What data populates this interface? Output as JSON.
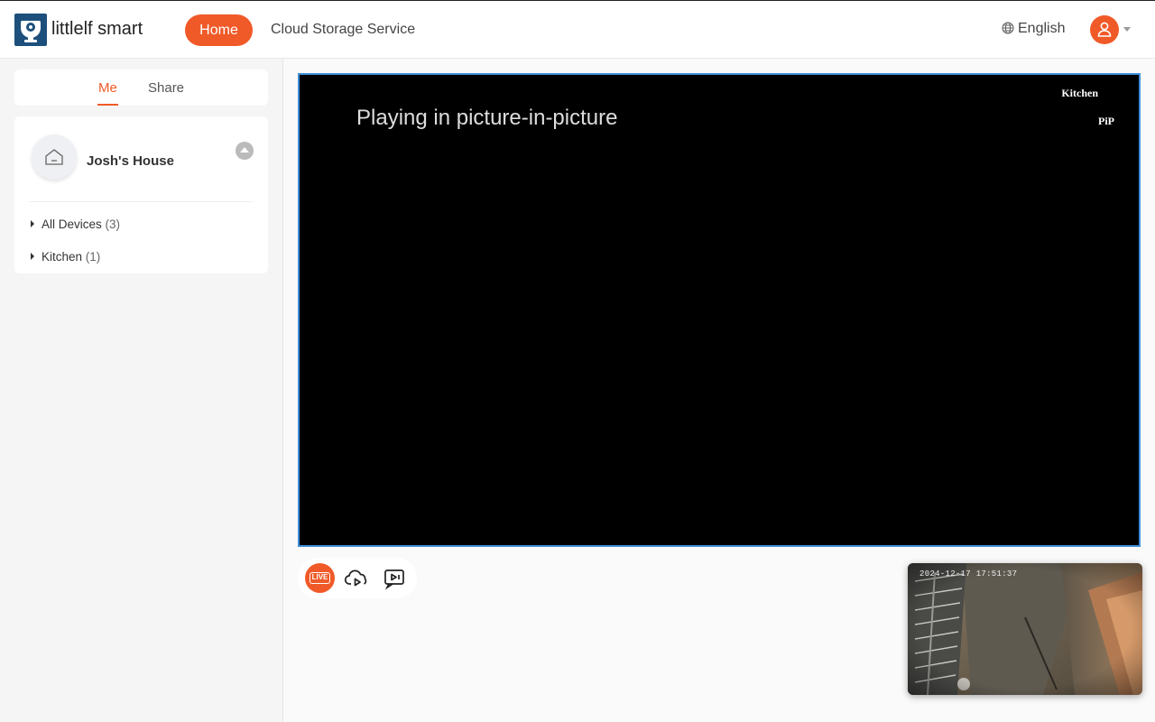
{
  "header": {
    "brand": "littlelf smart",
    "nav": {
      "home": "Home",
      "cloud": "Cloud Storage Service"
    },
    "language": "English",
    "accent_color": "#f05a28"
  },
  "sidebar": {
    "tabs": {
      "me": "Me",
      "share": "Share"
    },
    "house": {
      "name": "Josh's House"
    },
    "groups": [
      {
        "label": "All Devices",
        "count": "(3)"
      },
      {
        "label": "Kitchen",
        "count": "(1)"
      }
    ]
  },
  "player": {
    "status_text": "Playing in picture-in-picture",
    "camera_name": "Kitchen",
    "pip_label": "PiP",
    "live_label": "LIVE"
  },
  "pip_window": {
    "timestamp": "2024-12-17 17:51:37"
  }
}
